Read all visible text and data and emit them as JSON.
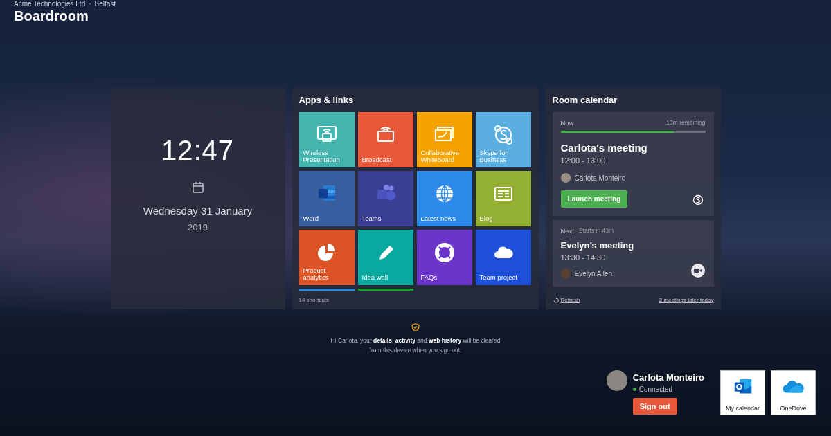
{
  "header": {
    "organization": "Acme Technologies Ltd",
    "separator": "·",
    "location": "Belfast",
    "room": "Boardroom"
  },
  "clock": {
    "time": "12:47",
    "date": "Wednesday 31 January",
    "year": "2019"
  },
  "apps": {
    "title": "Apps & links",
    "tiles": [
      {
        "label": "Wireless Presentation",
        "color": "#45b5b0"
      },
      {
        "label": "Broadcast",
        "color": "#e8583a"
      },
      {
        "label": "Collaborative Whiteboard",
        "color": "#f5a300"
      },
      {
        "label": "Skype for Business",
        "color": "#5aafe0"
      },
      {
        "label": "Word",
        "color": "#3a5fa0"
      },
      {
        "label": "Teams",
        "color": "#3b3f93"
      },
      {
        "label": "Latest news",
        "color": "#2d8ae8"
      },
      {
        "label": "Blog",
        "color": "#93b032"
      },
      {
        "label": "Product analytics",
        "color": "#dc5426"
      },
      {
        "label": "Idea wall",
        "color": "#0aa9a0"
      },
      {
        "label": "FAQs",
        "color": "#6a35c8"
      },
      {
        "label": "Team project",
        "color": "#1d4fd8"
      }
    ],
    "partial_tiles": [
      {
        "color": "#2f86e0"
      },
      {
        "color": "#13a02a"
      }
    ],
    "footer": "14 shortcuts"
  },
  "calendar": {
    "title": "Room calendar",
    "current": {
      "status": "Now",
      "remaining": "13m remaining",
      "level": 0.78,
      "title": "Carlota's meeting",
      "time": "12:00 - 13:00",
      "organizer": "Carlota Monteiro",
      "action": "Launch meeting"
    },
    "next": {
      "status": "Next",
      "starts": "Starts in 43m",
      "title": "Evelyn’s meeting",
      "time": "13:30 - 14:30",
      "organizer": "Evelyn Allen"
    },
    "refresh": "Refresh",
    "later": "2 meetings later today"
  },
  "privacy_note": "Hi Carlota, your **details**, **activity** and **web history** will be cleared from this device when you sign out.",
  "user": {
    "name": "Carlota Monteiro",
    "status": "Connected",
    "connected": true,
    "sign_out": "Sign out"
  },
  "shortcuts": [
    {
      "label": "My calendar"
    },
    {
      "label": "OneDrive"
    }
  ]
}
